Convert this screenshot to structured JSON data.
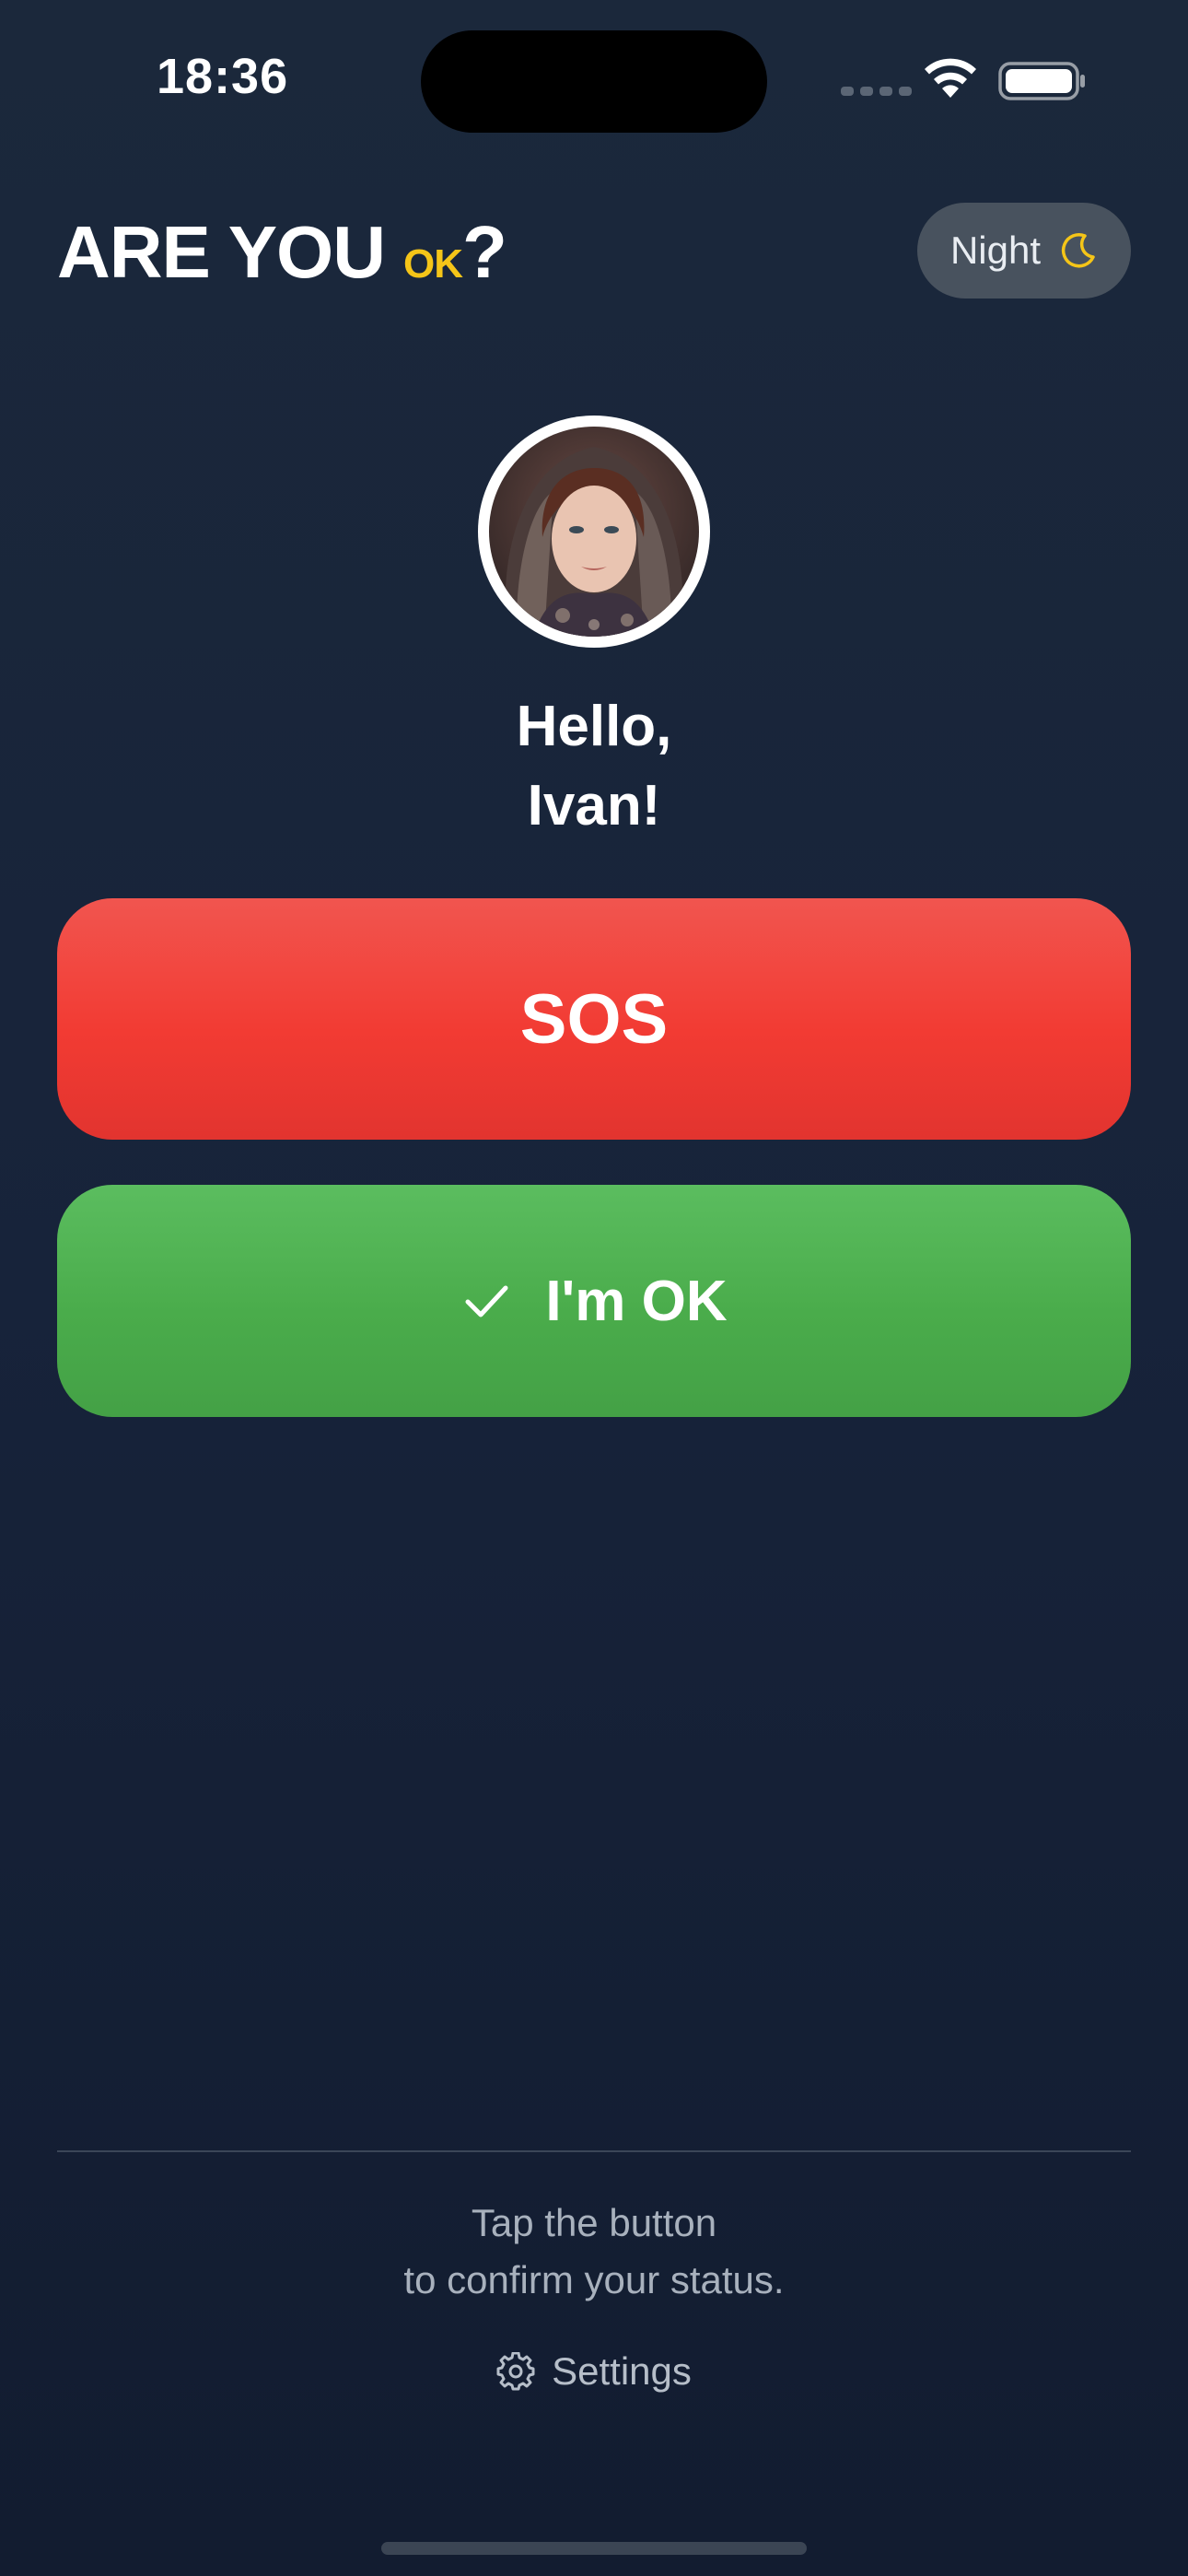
{
  "status_bar": {
    "time": "18:36"
  },
  "header": {
    "title_main": "ARE YOU",
    "title_accent": "OK",
    "title_end": "?",
    "night_toggle_label": "Night",
    "night_toggle_icon": "moon-icon"
  },
  "profile": {
    "greeting_line1": "Hello,",
    "greeting_line2": "Ivan!"
  },
  "actions": {
    "sos_label": "SOS",
    "ok_label": "I'm OK",
    "ok_icon": "check-icon"
  },
  "footer": {
    "hint_line1": "Tap the button",
    "hint_line2": "to confirm your status.",
    "settings_label": "Settings",
    "settings_icon": "gear-icon"
  },
  "colors": {
    "background": "#17233a",
    "accent_yellow": "#f5c518",
    "sos_red": "#f23b33",
    "ok_green": "#4aac4b",
    "toggle_bg": "#48525e"
  }
}
